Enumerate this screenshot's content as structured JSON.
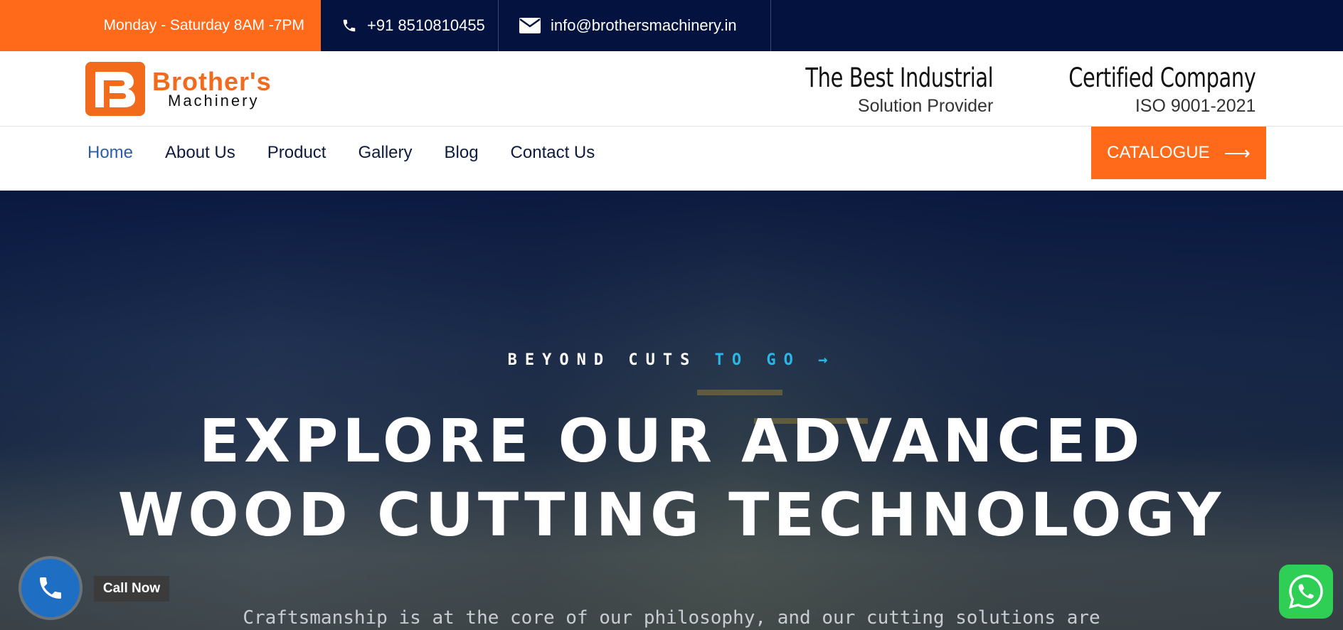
{
  "topbar": {
    "hours": "Monday - Saturday 8AM -7PM",
    "phone": "+91 8510810455",
    "email": "info@brothersmachinery.in"
  },
  "brand": {
    "name_line1": "Brother's",
    "name_line2": "Machinery"
  },
  "badges": [
    {
      "title": "The Best Industrial",
      "subtitle": "Solution Provider",
      "icon": "trophy-icon"
    },
    {
      "title": "Certified Company",
      "subtitle": "ISO 9001-2021",
      "icon": "approved-seal-icon"
    }
  ],
  "nav": {
    "items": [
      "Home",
      "About Us",
      "Product",
      "Gallery",
      "Blog",
      "Contact Us"
    ],
    "active": "Home",
    "catalogue_label": "CATALOGUE"
  },
  "hero": {
    "kicker_main": "BEYOND CUTS",
    "kicker_accent": "TO GO",
    "headline_line1": "EXPLORE OUR ADVANCED",
    "headline_line2": "WOOD CUTTING TECHNOLOGY",
    "subtext": "Craftsmanship is at the core of our philosophy, and our cutting solutions are"
  },
  "widgets": {
    "call_label": "Call Now"
  },
  "colors": {
    "accent_orange": "#ff6a1a",
    "navy": "#03123f",
    "link_active": "#2a5fa8",
    "kicker_accent": "#29b6e8",
    "whatsapp_green": "#2fcf55",
    "call_blue": "#1e6fc4"
  }
}
